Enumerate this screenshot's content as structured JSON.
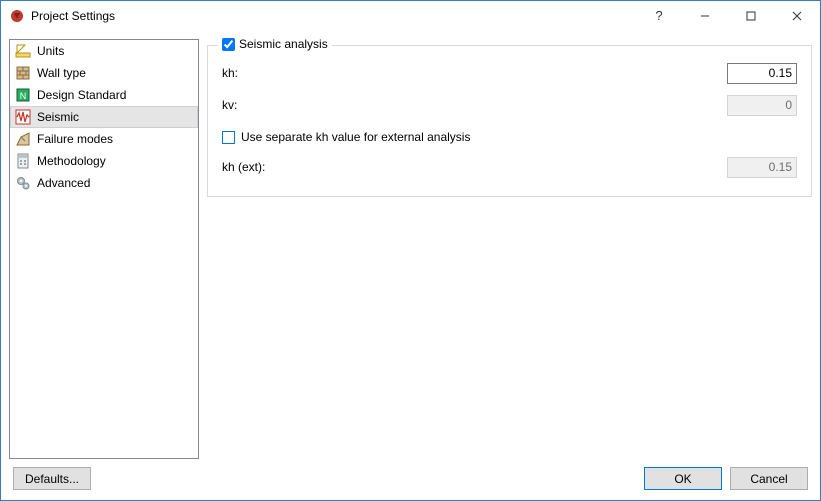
{
  "window": {
    "title": "Project Settings"
  },
  "sidebar": {
    "items": [
      {
        "label": "Units"
      },
      {
        "label": "Wall type"
      },
      {
        "label": "Design Standard"
      },
      {
        "label": "Seismic"
      },
      {
        "label": "Failure modes"
      },
      {
        "label": "Methodology"
      },
      {
        "label": "Advanced"
      }
    ]
  },
  "panel": {
    "seismic_checkbox_label": "Seismic analysis",
    "seismic_checked": true,
    "kh": {
      "label": "kh:",
      "value": "0.15"
    },
    "kv": {
      "label": "kv:",
      "value": "0"
    },
    "sep_checkbox_label": "Use separate kh value for external analysis",
    "sep_checked": false,
    "kh_ext": {
      "label": "kh (ext):",
      "value": "0.15"
    }
  },
  "footer": {
    "defaults": "Defaults...",
    "ok": "OK",
    "cancel": "Cancel"
  }
}
